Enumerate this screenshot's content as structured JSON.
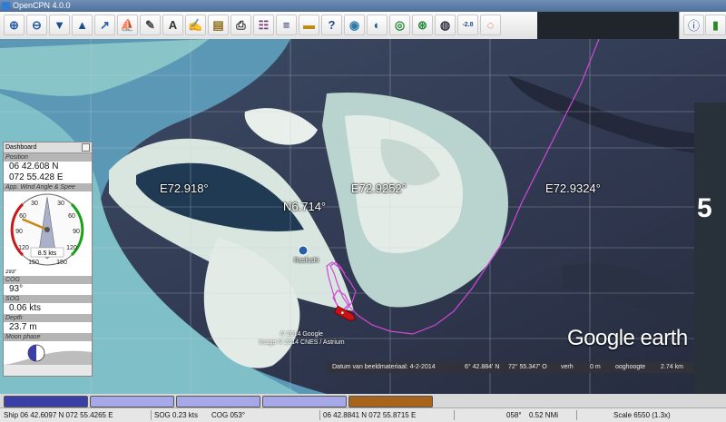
{
  "window": {
    "title": "OpenCPN 4.0.0"
  },
  "toolbar": {
    "buttons": [
      {
        "name": "zoom-in-icon",
        "glyph": "⊕",
        "color": "#2a5ea8"
      },
      {
        "name": "zoom-out-icon",
        "glyph": "⊖",
        "color": "#2a5ea8"
      },
      {
        "name": "scale-in-icon",
        "glyph": "▼",
        "color": "#1f4d8c"
      },
      {
        "name": "scale-out-icon",
        "glyph": "▲",
        "color": "#1f4d8c"
      },
      {
        "name": "route-icon",
        "glyph": "↗",
        "color": "#2a5ea8"
      },
      {
        "name": "ship-icon",
        "glyph": "⛵",
        "color": "#b01818"
      },
      {
        "name": "measure-icon",
        "glyph": "✎",
        "color": "#444"
      },
      {
        "name": "ais-icon",
        "glyph": "A",
        "color": "#333"
      },
      {
        "name": "track-icon",
        "glyph": "✍",
        "color": "#5c7a1a"
      },
      {
        "name": "chart-quilt-icon",
        "glyph": "▤",
        "color": "#8c6a1a"
      },
      {
        "name": "print-icon",
        "glyph": "⎙",
        "color": "#333"
      },
      {
        "name": "route-manager-icon",
        "glyph": "☷",
        "color": "#7a3a7a"
      },
      {
        "name": "mob-icon",
        "glyph": "≡",
        "color": "#2a2a6a"
      },
      {
        "name": "color-scheme-icon",
        "glyph": "▬",
        "color": "#c08a10"
      },
      {
        "name": "help-icon",
        "glyph": "?",
        "color": "#1f4d8c"
      },
      {
        "name": "world-chart-icon",
        "glyph": "◉",
        "color": "#2a7aa8"
      },
      {
        "name": "google-earth-icon",
        "glyph": "◐",
        "color": "#1a5a9a"
      },
      {
        "name": "radar-icon",
        "glyph": "◎",
        "color": "#2a8a3a"
      },
      {
        "name": "compass-icon",
        "glyph": "⊛",
        "color": "#2a8a3a"
      },
      {
        "name": "globe-icon",
        "glyph": "◍",
        "color": "#334"
      },
      {
        "name": "tide-icon",
        "glyph": "-2.8",
        "color": "#1f4d8c"
      },
      {
        "name": "lifebuoy-icon",
        "glyph": "◌",
        "color": "#d04a1a"
      }
    ],
    "status_icons": [
      {
        "name": "north-up-icon",
        "glyph": "ⓘ",
        "color": "#1f4d8c"
      },
      {
        "name": "signal-strength-icon",
        "glyph": "▮",
        "color": "#2a8a2a"
      }
    ]
  },
  "chart": {
    "meridian_labels": [
      "E72.918°",
      "E72.9252°",
      "E72.9324°"
    ],
    "parallel_label": "N6.714°",
    "place_name": "Rasfushi",
    "google_logo": "Google earth",
    "copyright": [
      "© 2014 Google",
      "Image © 2014 CNES / Astrium"
    ],
    "edge_label": "5",
    "info": {
      "imagery_date": "Datum van beeldmateriaal: 4-2-2014",
      "lat": "6° 42.884' N",
      "lon": "72° 55.347' O",
      "verh": "verh",
      "elev": "0 m",
      "eye_label": "ooghoogte",
      "eye_alt": "2.74 km"
    },
    "track_color": "#d048d8",
    "ship_color": "#c81414"
  },
  "dashboard": {
    "title": "Dashboard",
    "position": {
      "label": "Position",
      "lat": "06 42.608 N",
      "lon": "072 55.428 E"
    },
    "wind": {
      "label": "App. Wind Angle & Spee",
      "dial_top": [
        "30",
        "30"
      ],
      "dial_mid": [
        "60",
        "60"
      ],
      "dial_side": [
        "90",
        "90"
      ],
      "dial_low": [
        "120",
        "120"
      ],
      "dial_bottom": [
        "150",
        "150"
      ],
      "speed": "8.5 kts",
      "angle_readout": "293°",
      "wind_angle_deg": 293
    },
    "cog": {
      "label": "COG",
      "value": "93°"
    },
    "sog": {
      "label": "SOG",
      "value": "0.06 kts"
    },
    "depth": {
      "label": "Depth",
      "value": "23.7 m"
    },
    "moon": {
      "label": "Moon phase"
    }
  },
  "tabs": [
    {
      "color": "#3a3fa8"
    },
    {
      "color": "#a7a8e8"
    },
    {
      "color": "#a7a8e8"
    },
    {
      "color": "#a7a8e8"
    },
    {
      "color": "#a8641a"
    }
  ],
  "status": {
    "ship": "Ship 06 42.6097 N   072 55.4265 E",
    "sog": "SOG 0.23 kts",
    "cog": "COG 053°",
    "cursor": "06 42.8841 N   072 55.8715 E",
    "bearing": "058°",
    "distance": "0.52 NMi",
    "scale": "Scale 6550 (1.3x)"
  }
}
